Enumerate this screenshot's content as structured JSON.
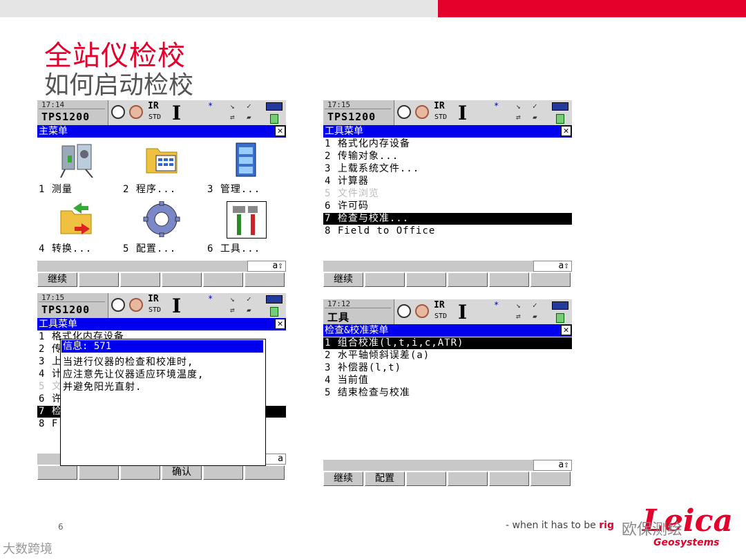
{
  "slide": {
    "title": "全站仪检校",
    "subtitle": "如何启动检校",
    "page_number": "6",
    "tagline_prefix": "- when it has to be ",
    "tagline_highlight": "rig",
    "logo_text": "Leica",
    "logo_sub": "Geosystems",
    "watermark_left": "大数跨境",
    "watermark_right": "欧保测绘"
  },
  "status_common": {
    "instrument": "TPS1200",
    "ir": "IR",
    "std": "STD",
    "cursor": "I",
    "bluetooth": "*"
  },
  "screens": {
    "s1": {
      "time": "17:14",
      "instrument": "TPS1200",
      "title": "主菜单",
      "icons": [
        {
          "label": "1 测量",
          "icon": "survey-instrument-icon"
        },
        {
          "label": "2 程序...",
          "icon": "programs-folder-icon"
        },
        {
          "label": "3 管理...",
          "icon": "manage-cabinet-icon"
        },
        {
          "label": "4 转换...",
          "icon": "convert-folder-icon"
        },
        {
          "label": "5 配置...",
          "icon": "config-gear-icon"
        },
        {
          "label": "6 工具...",
          "icon": "tools-icon"
        }
      ],
      "mode": "a⇧",
      "fkeys": [
        "继续",
        "",
        "",
        "",
        "",
        ""
      ]
    },
    "s2": {
      "time": "17:15",
      "instrument": "TPS1200",
      "title": "工具菜单",
      "items": [
        "1 格式化内存设备",
        "2 传输对象...",
        "3 上载系统文件...",
        "4 计算器",
        "5 文件浏览",
        "6 许可码",
        "7 检查与校准...",
        "8 Field to Office"
      ],
      "selected_index": 6,
      "disabled_index": 4,
      "mode": "a⇧",
      "fkeys": [
        "继续",
        "",
        "",
        "",
        "",
        ""
      ]
    },
    "s3": {
      "time": "17:15",
      "instrument": "TPS1200",
      "title": "工具菜单",
      "items_partial": [
        "1 格式化内存设备",
        "2 传",
        "3 上",
        "4 计",
        "5 文",
        "6 许",
        "7 检",
        "8 F"
      ],
      "dialog": {
        "title": "信息: 571",
        "lines": [
          "当进行仪器的检查和校准时,",
          "应注意先让仪器适应环境温度,",
          "并避免阳光直射."
        ]
      },
      "mode": "a",
      "fkeys": [
        "",
        "",
        "",
        "确认",
        "",
        ""
      ]
    },
    "s4": {
      "time": "17:12",
      "instrument": "工具",
      "title": "检查&校准菜单",
      "items": [
        "1 组合校准(l,t,i,c,ATR)",
        "2 水平轴倾斜误差(a)",
        "3 补偿器(l,t)",
        "4 当前值",
        "5 结束检查与校准"
      ],
      "selected_index": 0,
      "mode": "a⇧",
      "fkeys": [
        "继续",
        "配置",
        "",
        "",
        "",
        ""
      ]
    }
  }
}
